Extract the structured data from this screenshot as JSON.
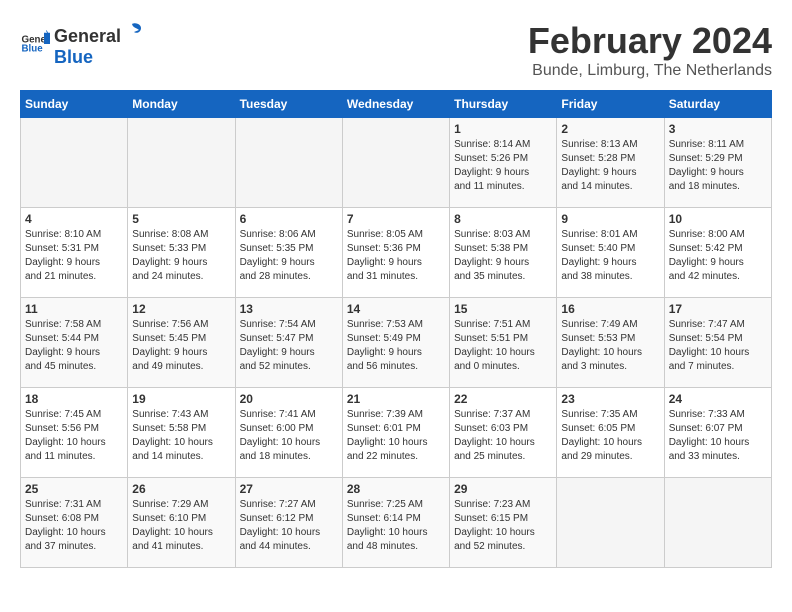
{
  "header": {
    "logo_general": "General",
    "logo_blue": "Blue",
    "title": "February 2024",
    "subtitle": "Bunde, Limburg, The Netherlands"
  },
  "weekdays": [
    "Sunday",
    "Monday",
    "Tuesday",
    "Wednesday",
    "Thursday",
    "Friday",
    "Saturday"
  ],
  "weeks": [
    [
      {
        "day": "",
        "info": ""
      },
      {
        "day": "",
        "info": ""
      },
      {
        "day": "",
        "info": ""
      },
      {
        "day": "",
        "info": ""
      },
      {
        "day": "1",
        "info": "Sunrise: 8:14 AM\nSunset: 5:26 PM\nDaylight: 9 hours\nand 11 minutes."
      },
      {
        "day": "2",
        "info": "Sunrise: 8:13 AM\nSunset: 5:28 PM\nDaylight: 9 hours\nand 14 minutes."
      },
      {
        "day": "3",
        "info": "Sunrise: 8:11 AM\nSunset: 5:29 PM\nDaylight: 9 hours\nand 18 minutes."
      }
    ],
    [
      {
        "day": "4",
        "info": "Sunrise: 8:10 AM\nSunset: 5:31 PM\nDaylight: 9 hours\nand 21 minutes."
      },
      {
        "day": "5",
        "info": "Sunrise: 8:08 AM\nSunset: 5:33 PM\nDaylight: 9 hours\nand 24 minutes."
      },
      {
        "day": "6",
        "info": "Sunrise: 8:06 AM\nSunset: 5:35 PM\nDaylight: 9 hours\nand 28 minutes."
      },
      {
        "day": "7",
        "info": "Sunrise: 8:05 AM\nSunset: 5:36 PM\nDaylight: 9 hours\nand 31 minutes."
      },
      {
        "day": "8",
        "info": "Sunrise: 8:03 AM\nSunset: 5:38 PM\nDaylight: 9 hours\nand 35 minutes."
      },
      {
        "day": "9",
        "info": "Sunrise: 8:01 AM\nSunset: 5:40 PM\nDaylight: 9 hours\nand 38 minutes."
      },
      {
        "day": "10",
        "info": "Sunrise: 8:00 AM\nSunset: 5:42 PM\nDaylight: 9 hours\nand 42 minutes."
      }
    ],
    [
      {
        "day": "11",
        "info": "Sunrise: 7:58 AM\nSunset: 5:44 PM\nDaylight: 9 hours\nand 45 minutes."
      },
      {
        "day": "12",
        "info": "Sunrise: 7:56 AM\nSunset: 5:45 PM\nDaylight: 9 hours\nand 49 minutes."
      },
      {
        "day": "13",
        "info": "Sunrise: 7:54 AM\nSunset: 5:47 PM\nDaylight: 9 hours\nand 52 minutes."
      },
      {
        "day": "14",
        "info": "Sunrise: 7:53 AM\nSunset: 5:49 PM\nDaylight: 9 hours\nand 56 minutes."
      },
      {
        "day": "15",
        "info": "Sunrise: 7:51 AM\nSunset: 5:51 PM\nDaylight: 10 hours\nand 0 minutes."
      },
      {
        "day": "16",
        "info": "Sunrise: 7:49 AM\nSunset: 5:53 PM\nDaylight: 10 hours\nand 3 minutes."
      },
      {
        "day": "17",
        "info": "Sunrise: 7:47 AM\nSunset: 5:54 PM\nDaylight: 10 hours\nand 7 minutes."
      }
    ],
    [
      {
        "day": "18",
        "info": "Sunrise: 7:45 AM\nSunset: 5:56 PM\nDaylight: 10 hours\nand 11 minutes."
      },
      {
        "day": "19",
        "info": "Sunrise: 7:43 AM\nSunset: 5:58 PM\nDaylight: 10 hours\nand 14 minutes."
      },
      {
        "day": "20",
        "info": "Sunrise: 7:41 AM\nSunset: 6:00 PM\nDaylight: 10 hours\nand 18 minutes."
      },
      {
        "day": "21",
        "info": "Sunrise: 7:39 AM\nSunset: 6:01 PM\nDaylight: 10 hours\nand 22 minutes."
      },
      {
        "day": "22",
        "info": "Sunrise: 7:37 AM\nSunset: 6:03 PM\nDaylight: 10 hours\nand 25 minutes."
      },
      {
        "day": "23",
        "info": "Sunrise: 7:35 AM\nSunset: 6:05 PM\nDaylight: 10 hours\nand 29 minutes."
      },
      {
        "day": "24",
        "info": "Sunrise: 7:33 AM\nSunset: 6:07 PM\nDaylight: 10 hours\nand 33 minutes."
      }
    ],
    [
      {
        "day": "25",
        "info": "Sunrise: 7:31 AM\nSunset: 6:08 PM\nDaylight: 10 hours\nand 37 minutes."
      },
      {
        "day": "26",
        "info": "Sunrise: 7:29 AM\nSunset: 6:10 PM\nDaylight: 10 hours\nand 41 minutes."
      },
      {
        "day": "27",
        "info": "Sunrise: 7:27 AM\nSunset: 6:12 PM\nDaylight: 10 hours\nand 44 minutes."
      },
      {
        "day": "28",
        "info": "Sunrise: 7:25 AM\nSunset: 6:14 PM\nDaylight: 10 hours\nand 48 minutes."
      },
      {
        "day": "29",
        "info": "Sunrise: 7:23 AM\nSunset: 6:15 PM\nDaylight: 10 hours\nand 52 minutes."
      },
      {
        "day": "",
        "info": ""
      },
      {
        "day": "",
        "info": ""
      }
    ]
  ]
}
